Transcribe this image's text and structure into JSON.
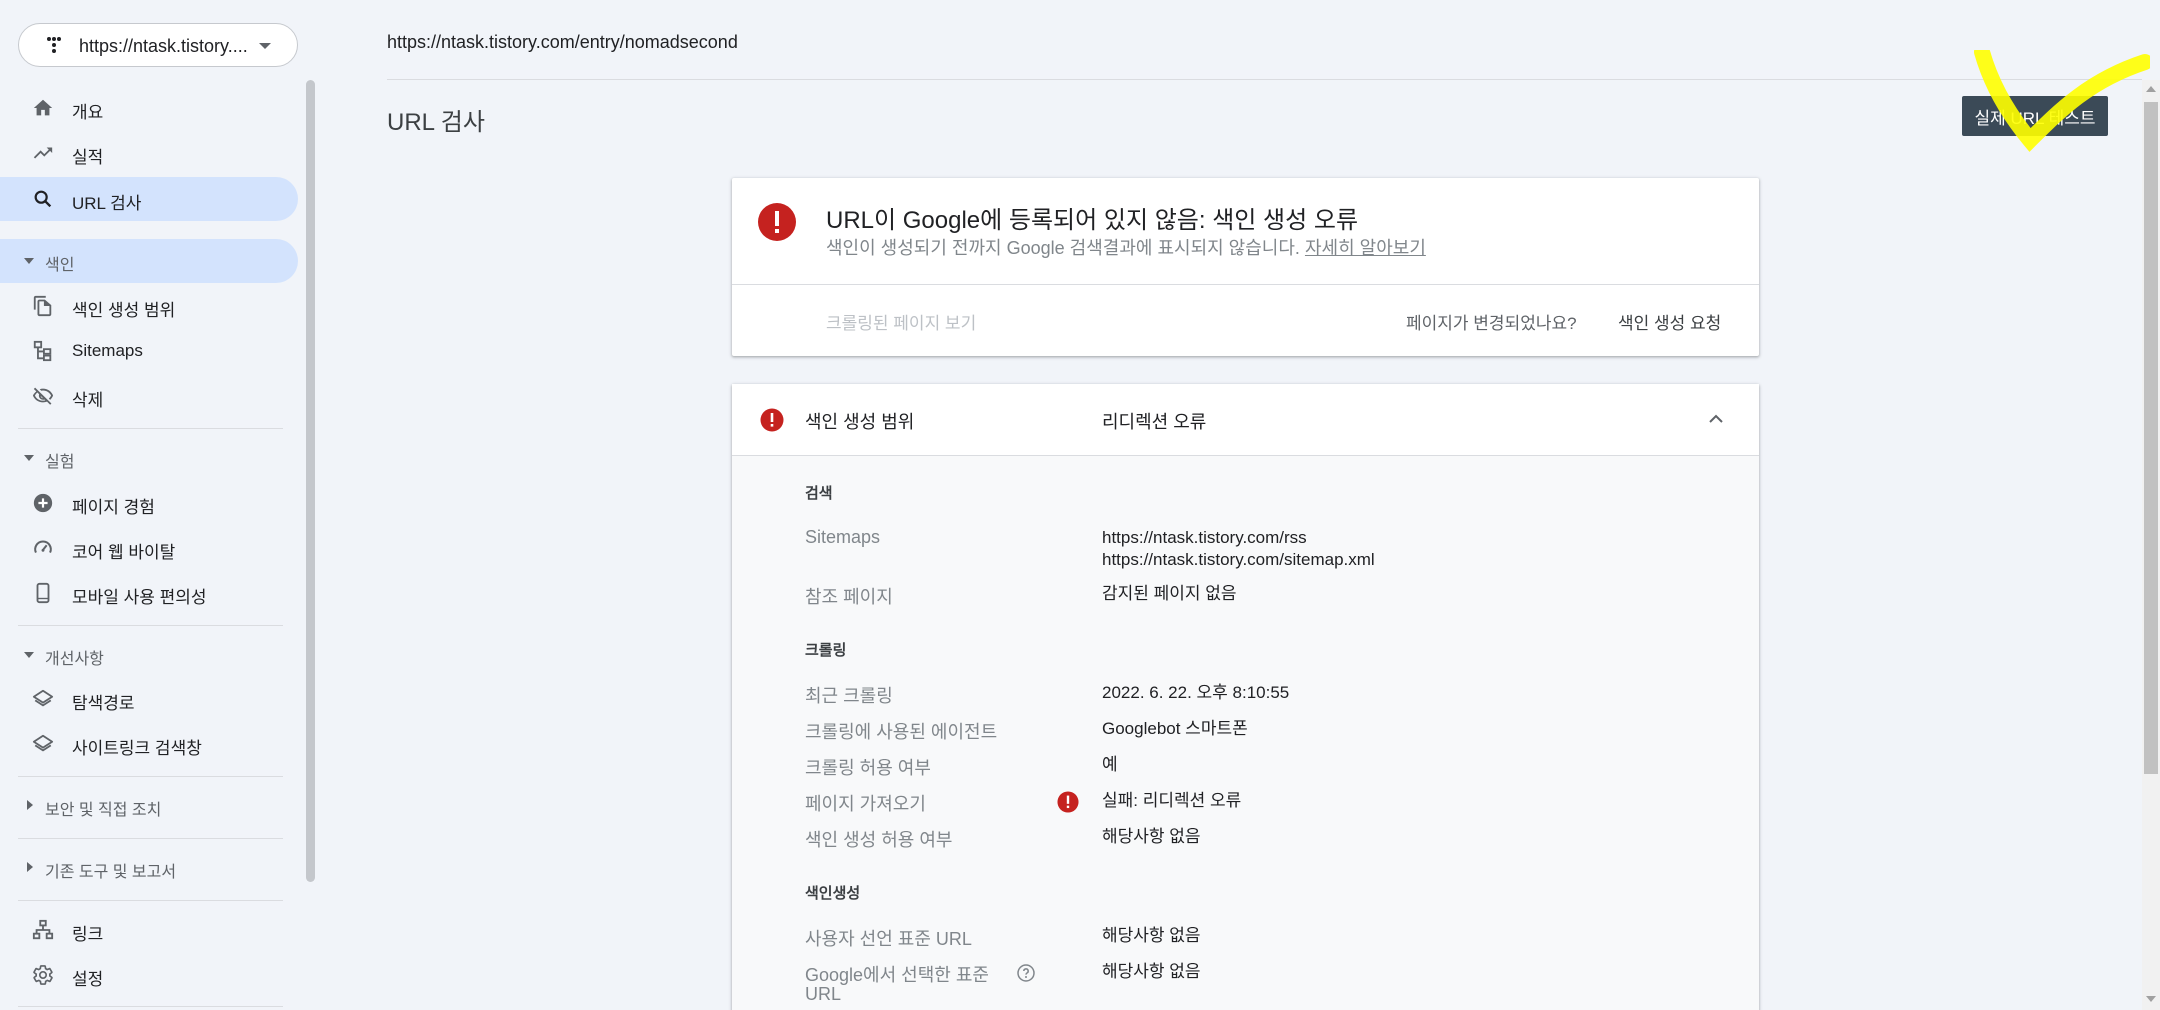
{
  "sidebar": {
    "property": "https://ntask.tistory....",
    "items": [
      {
        "label": "개요",
        "icon": "home-icon"
      },
      {
        "label": "실적",
        "icon": "trending-up-icon"
      },
      {
        "label": "URL 검사",
        "icon": "search-icon",
        "selected": true
      }
    ],
    "sections": {
      "index": {
        "label": "색인",
        "items": [
          {
            "label": "색인 생성 범위",
            "icon": "file-copy-icon"
          },
          {
            "label": "Sitemaps",
            "icon": "sitemap-icon"
          },
          {
            "label": "삭제",
            "icon": "visibility-off-icon"
          }
        ]
      },
      "experience": {
        "label": "실험",
        "items": [
          {
            "label": "페이지 경험",
            "icon": "add-circle-icon"
          },
          {
            "label": "코어 웹 바이탈",
            "icon": "speed-icon"
          },
          {
            "label": "모바일 사용 편의성",
            "icon": "smartphone-icon"
          }
        ]
      },
      "enhancements": {
        "label": "개선사항",
        "items": [
          {
            "label": "탐색경로",
            "icon": "layers-icon"
          },
          {
            "label": "사이트링크 검색창",
            "icon": "layers-icon"
          }
        ]
      },
      "security": {
        "label": "보안 및 직접 조치"
      },
      "legacy": {
        "label": "기존 도구 및 보고서"
      }
    },
    "bottom_items": [
      {
        "label": "링크",
        "icon": "links-icon"
      },
      {
        "label": "설정",
        "icon": "settings-icon"
      }
    ]
  },
  "header": {
    "inspected_url": "https://ntask.tistory.com/entry/nomadsecond",
    "page_title": "URL 검사",
    "live_test_button": "실제 URL 테스트"
  },
  "status_card": {
    "title": "URL이 Google에 등록되어 있지 않음: 색인 생성 오류",
    "subtitle": "색인이 생성되기 전까지 Google 검색결과에 표시되지 않습니다.",
    "learn_more": "자세히 알아보기",
    "view_crawled": "크롤링된 페이지 보기",
    "page_changed": "페이지가 변경되었나요?",
    "request_indexing": "색인 생성 요청"
  },
  "coverage": {
    "title": "색인 생성 범위",
    "status": "리디렉션 오류",
    "discovery": {
      "heading": "검색",
      "sitemaps_label": "Sitemaps",
      "sitemaps": [
        "https://ntask.tistory.com/rss",
        "https://ntask.tistory.com/sitemap.xml"
      ],
      "referring_label": "참조 페이지",
      "referring_value": "감지된 페이지 없음"
    },
    "crawl": {
      "heading": "크롤링",
      "last_crawl_label": "최근 크롤링",
      "last_crawl_value": "2022. 6. 22. 오후 8:10:55",
      "crawled_as_label": "크롤링에 사용된 에이전트",
      "crawled_as_value": "Googlebot 스마트폰",
      "crawl_allowed_label": "크롤링 허용 여부",
      "crawl_allowed_value": "예",
      "page_fetch_label": "페이지 가져오기",
      "page_fetch_value": "실패: 리디렉션 오류",
      "indexing_allowed_label": "색인 생성 허용 여부",
      "indexing_allowed_value": "해당사항 없음"
    },
    "indexing": {
      "heading": "색인생성",
      "user_canonical_label": "사용자 선언 표준 URL",
      "user_canonical_value": "해당사항 없음",
      "google_canonical_label_1": "Google에서 선택한 표준",
      "google_canonical_label_2": "URL",
      "google_canonical_value": "해당사항 없음"
    }
  },
  "colors": {
    "error": "#c5221f",
    "selected_bg": "#d3e3fd",
    "button_bg": "#3b4a57",
    "highlight": "#ffff00"
  }
}
